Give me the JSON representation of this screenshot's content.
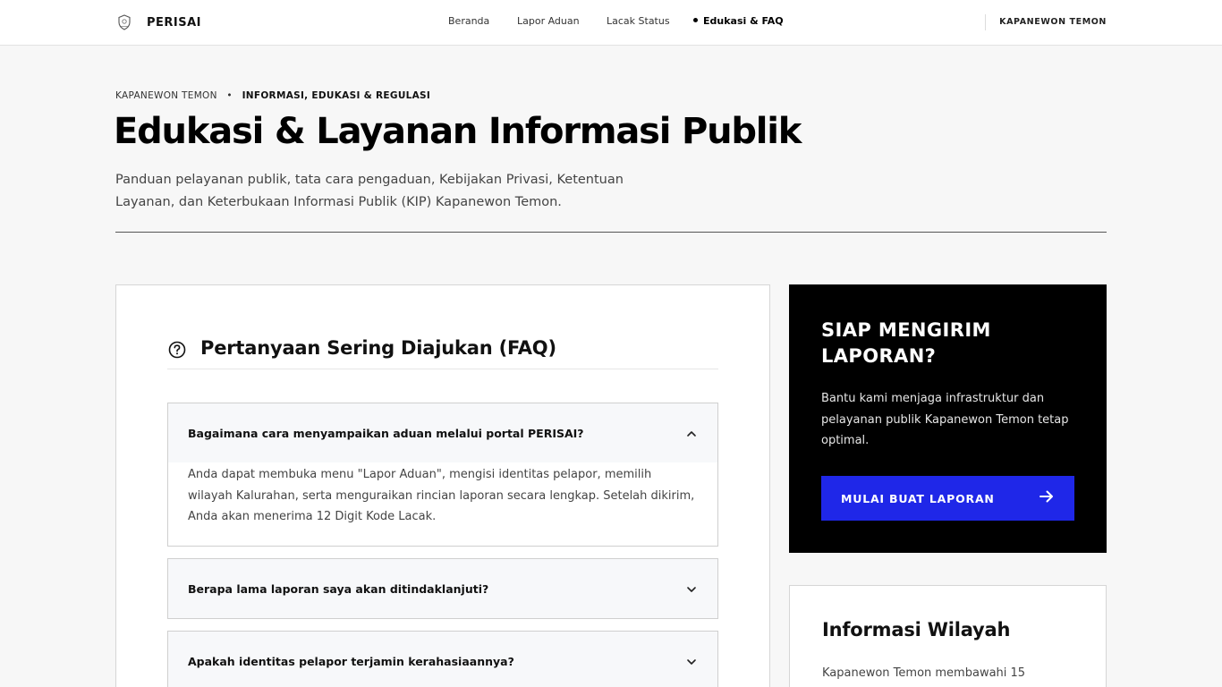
{
  "header": {
    "brand_name": "PERISAI",
    "logo_icon": "shield-crest-icon",
    "nav": [
      {
        "label": "Beranda"
      },
      {
        "label": "Lapor Aduan"
      },
      {
        "label": "Lacak Status"
      },
      {
        "label": "Edukasi & FAQ",
        "active": true
      }
    ],
    "region": "KAPANEWON TEMON"
  },
  "hero": {
    "breadcrumb": [
      "KAPANEWON TEMON",
      "INFORMASI, EDUKASI & REGULASI"
    ],
    "breadcrumb_separator": "•",
    "title": "Edukasi & Layanan Informasi Publik",
    "description": "Panduan pelayanan publik, tata cara pengaduan, Kebijakan Privasi, Ketentuan Layanan, dan Keterbukaan Informasi Publik (KIP) Kapanewon Temon."
  },
  "faq": {
    "icon": "question-circle-icon",
    "title": "Pertanyaan Sering Diajukan (FAQ)",
    "items": [
      {
        "question": "Bagaimana cara menyampaikan aduan melalui portal PERISAI?",
        "answer": "Anda dapat membuka menu \"Lapor Aduan\", mengisi identitas pelapor, memilih wilayah Kalurahan, serta menguraikan rincian laporan secara lengkap. Setelah dikirim, Anda akan menerima 12 Digit Kode Lacak.",
        "expanded": true
      },
      {
        "question": "Berapa lama laporan saya akan ditindaklanjuti?",
        "expanded": false
      },
      {
        "question": "Apakah identitas pelapor terjamin kerahasiaannya?",
        "expanded": false
      }
    ]
  },
  "cta": {
    "title": "SIAP MENGIRIM LAPORAN?",
    "description": "Bantu kami menjaga infrastruktur dan pelayanan publik Kapanewon Temon tetap optimal.",
    "button_label": "MULAI BUAT LAPORAN",
    "button_icon": "arrow-right-icon",
    "button_color": "#1f27e8"
  },
  "info": {
    "title": "Informasi Wilayah",
    "text": "Kapanewon Temon membawahi 15"
  }
}
